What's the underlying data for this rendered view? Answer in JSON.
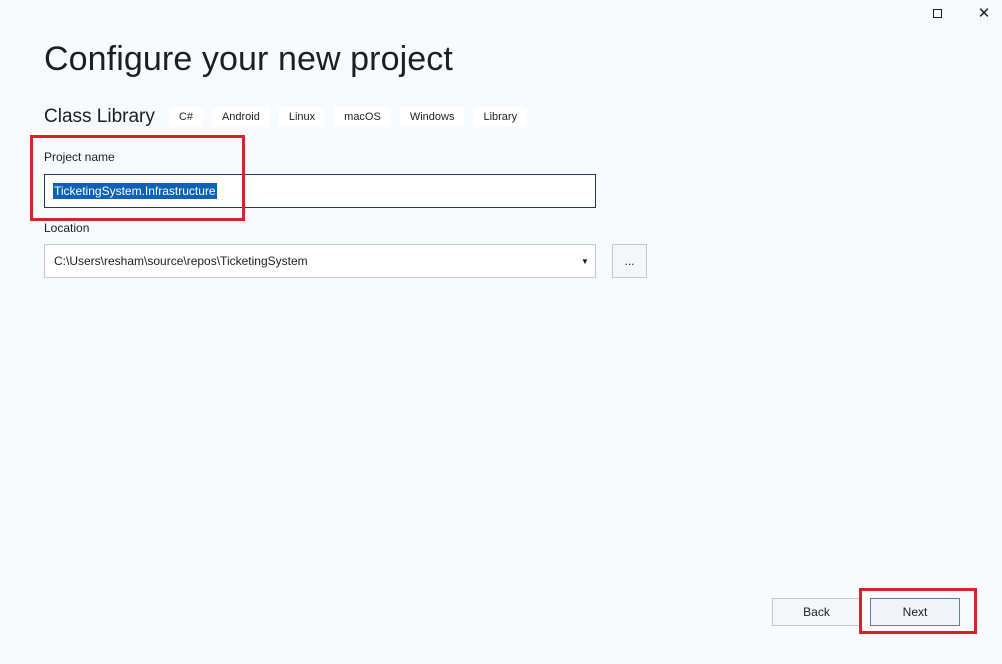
{
  "window_controls": {
    "maximize_icon": "maximize-icon",
    "close_icon": "close-icon",
    "close_glyph": "✕"
  },
  "page": {
    "title": "Configure your new project"
  },
  "template": {
    "name": "Class Library",
    "tags": [
      "C#",
      "Android",
      "Linux",
      "macOS",
      "Windows",
      "Library"
    ]
  },
  "project_name": {
    "label": "Project name",
    "value": "TicketingSystem.Infrastructure"
  },
  "location": {
    "label": "Location",
    "value": "C:\\Users\\resham\\source\\repos\\TicketingSystem",
    "dropdown_icon": "chevron-down-icon",
    "browse_label": "..."
  },
  "footer": {
    "back_label": "Back",
    "next_label": "Next"
  },
  "colors": {
    "background": "#f9fafd",
    "highlight": "#d9232a",
    "selection": "#0e62b6"
  }
}
